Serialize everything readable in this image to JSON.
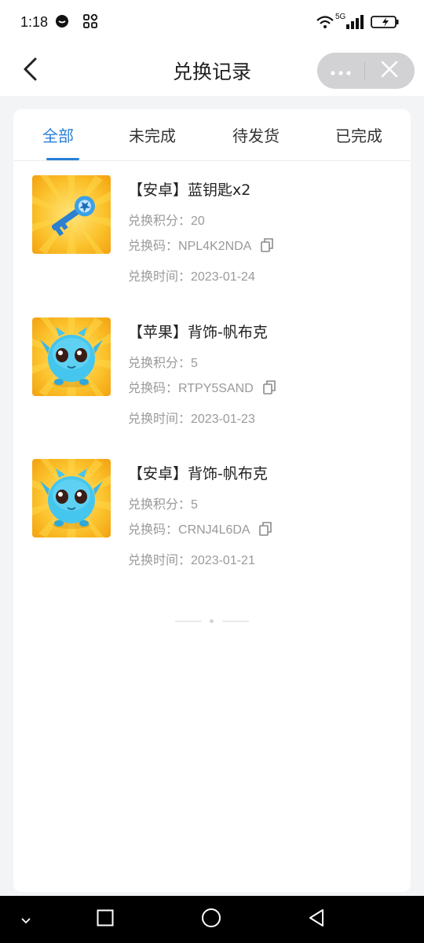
{
  "status_bar": {
    "time": "1:18",
    "network": "5G",
    "icons": [
      "chat-bubble-icon",
      "app-grid-icon",
      "wifi-icon",
      "signal-icon",
      "battery-icon"
    ]
  },
  "navbar": {
    "title": "兑换记录",
    "icons": [
      "back-arrow-icon",
      "more-dots-icon",
      "close-icon"
    ]
  },
  "tabs": [
    {
      "label": "全部",
      "active": true
    },
    {
      "label": "未完成",
      "active": false
    },
    {
      "label": "待发货",
      "active": false
    },
    {
      "label": "已完成",
      "active": false
    }
  ],
  "colors": {
    "accent": "#2b7fd8",
    "thumb_bg": "#f9b81b",
    "key_blue": "#3aa0e8",
    "creature_blue": "#45c6ee"
  },
  "records": [
    {
      "title": "【安卓】蓝钥匙x2",
      "points": "兑换积分：20",
      "code_label": "兑换码：",
      "code": "NPL4K2NDA",
      "time": "兑换时间：2023-01-24",
      "image": "blue-key-icon"
    },
    {
      "title": "【苹果】背饰-帆布克",
      "points": "兑换积分：5",
      "code_label": "兑换码：",
      "code": "RTPY5SAND",
      "time": "兑换时间：2023-01-23",
      "image": "blue-creature-icon"
    },
    {
      "title": "【安卓】背饰-帆布克",
      "points": "兑换积分：5",
      "code_label": "兑换码：",
      "code": "CRNJ4L6DA",
      "time": "兑换时间：2023-01-21",
      "image": "blue-creature-icon"
    }
  ],
  "system_nav": {
    "icons": [
      "chevron-down-icon",
      "recents-square-icon",
      "home-circle-icon",
      "back-triangle-icon"
    ]
  }
}
